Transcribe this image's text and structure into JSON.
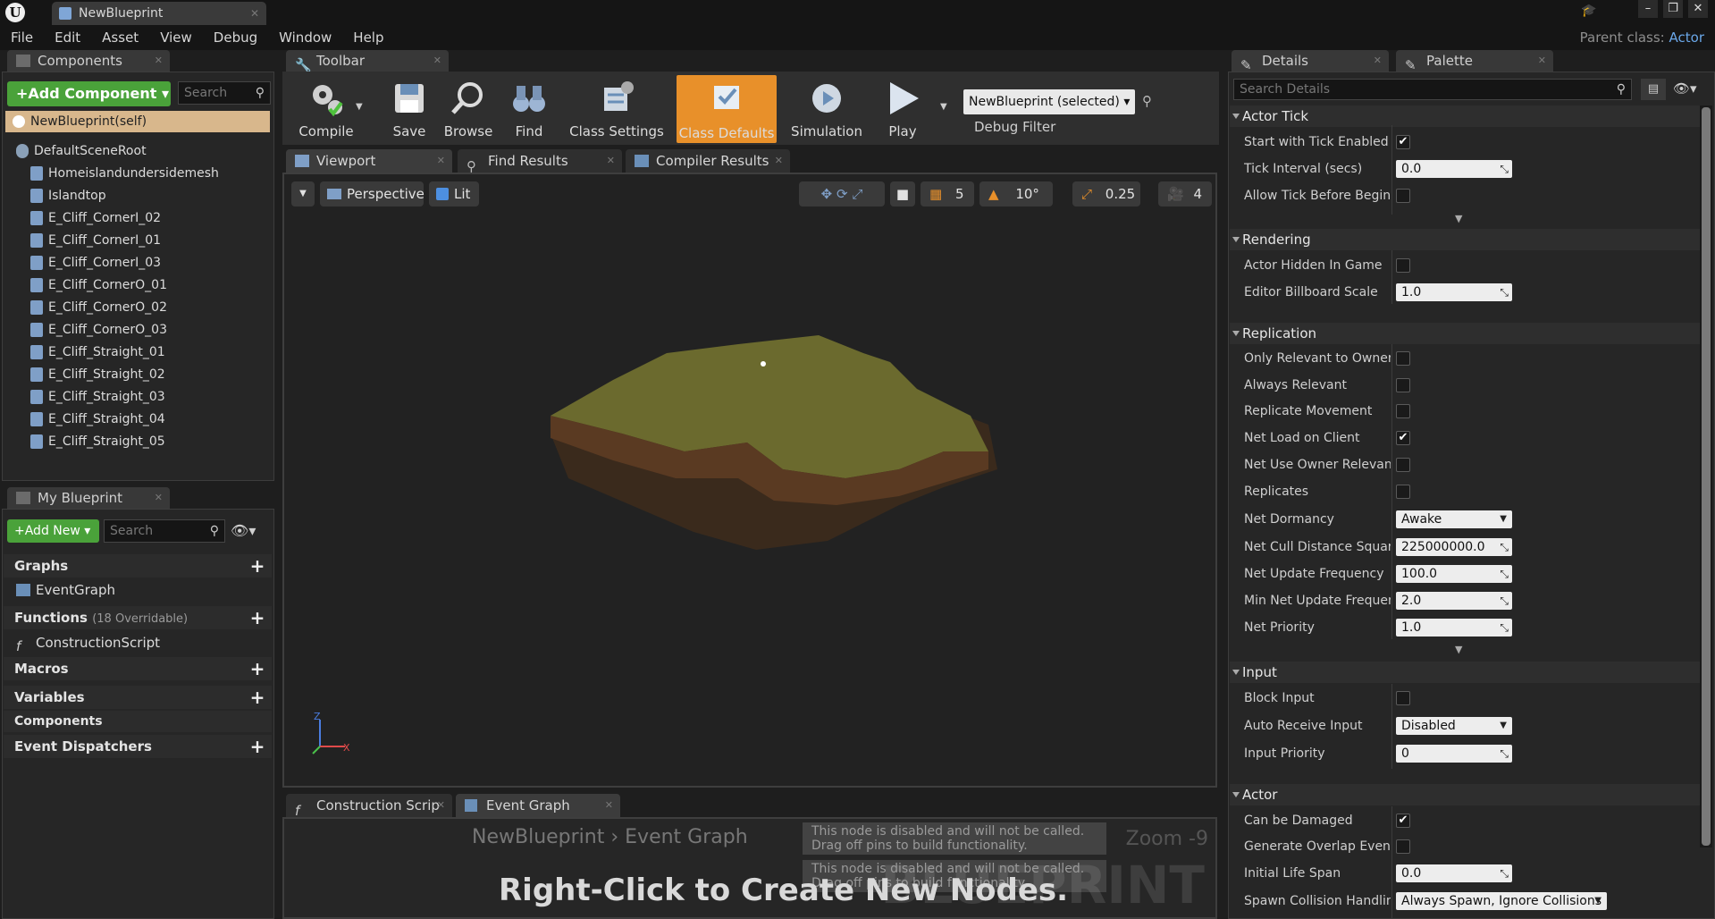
{
  "window": {
    "tab_title": "NewBlueprint",
    "parent_class_label": "Parent class:",
    "parent_class_value": "Actor",
    "logo": "U"
  },
  "menu": [
    "File",
    "Edit",
    "Asset",
    "View",
    "Debug",
    "Window",
    "Help"
  ],
  "components_panel": {
    "tab": "Components",
    "add_button": "+Add Component ▾",
    "search_placeholder": "Search",
    "self": "NewBlueprint(self)",
    "root": "DefaultSceneRoot",
    "items": [
      "Homeislandundersidemesh",
      "Islandtop",
      "E_Cliff_CornerI_02",
      "E_Cliff_CornerI_01",
      "E_Cliff_CornerI_03",
      "E_Cliff_CornerO_01",
      "E_Cliff_CornerO_02",
      "E_Cliff_CornerO_03",
      "E_Cliff_Straight_01",
      "E_Cliff_Straight_02",
      "E_Cliff_Straight_03",
      "E_Cliff_Straight_04",
      "E_Cliff_Straight_05"
    ]
  },
  "my_blueprint": {
    "tab": "My Blueprint",
    "add_button": "+Add New ▾",
    "search_placeholder": "Search",
    "graphs": "Graphs",
    "event_graph": "EventGraph",
    "functions": "Functions",
    "functions_sub": "(18 Overridable)",
    "construction_script": "ConstructionScript",
    "macros": "Macros",
    "variables": "Variables",
    "components": "Components",
    "event_dispatchers": "Event Dispatchers"
  },
  "toolbar": {
    "tab": "Toolbar",
    "buttons": [
      "Compile",
      "Save",
      "Browse",
      "Find",
      "Class Settings",
      "Class Defaults",
      "Simulation",
      "Play"
    ],
    "debug_selected": "NewBlueprint (selected) ▾",
    "debug_filter": "Debug Filter",
    "active_color": "#e8902a"
  },
  "viewport": {
    "tabs": [
      "Viewport",
      "Find Results",
      "Compiler Results"
    ],
    "perspective": "Perspective",
    "lit": "Lit",
    "grid_snap": "5",
    "rotation_snap": "10°",
    "scale_snap": "0.25",
    "camera_speed": "4"
  },
  "graph": {
    "tabs": [
      "Construction Scrip",
      "Event Graph"
    ],
    "hint": "Right-Click to Create New Nodes.",
    "crumb": "NewBlueprint  ›  Event Graph",
    "zoom": "Zoom -9",
    "watermark": "BLUEPRINT",
    "note1": "This node is disabled and will not be called.",
    "note2": "Drag off pins to build functionality."
  },
  "details": {
    "tabs": [
      "Details",
      "Palette"
    ],
    "search_placeholder": "Search Details",
    "categories": {
      "actor_tick": "Actor Tick",
      "rendering": "Rendering",
      "replication": "Replication",
      "input": "Input",
      "actor": "Actor"
    },
    "props": {
      "start_tick": "Start with Tick Enabled",
      "tick_interval": "Tick Interval (secs)",
      "tick_interval_val": "0.0",
      "allow_tick": "Allow Tick Before Begin P",
      "hidden_in_game": "Actor Hidden In Game",
      "billboard_scale": "Editor Billboard Scale",
      "billboard_scale_val": "1.0",
      "only_relevant": "Only Relevant to Owner",
      "always_relevant": "Always Relevant",
      "replicate_movement": "Replicate Movement",
      "net_load": "Net Load on Client",
      "net_owner": "Net Use Owner Relevancy",
      "replicates": "Replicates",
      "net_dormancy": "Net Dormancy",
      "net_dormancy_val": "Awake",
      "net_cull": "Net Cull Distance Squared",
      "net_cull_val": "225000000.0",
      "net_update": "Net Update Frequency",
      "net_update_val": "100.0",
      "min_net_update": "Min Net Update Frequency",
      "min_net_update_val": "2.0",
      "net_priority": "Net Priority",
      "net_priority_val": "1.0",
      "block_input": "Block Input",
      "auto_input": "Auto Receive Input",
      "auto_input_val": "Disabled",
      "input_priority": "Input Priority",
      "input_priority_val": "0",
      "can_be_damaged": "Can be Damaged",
      "overlap_events": "Generate Overlap Events",
      "life_span": "Initial Life Span",
      "life_span_val": "0.0",
      "spawn_collision": "Spawn Collision Handling",
      "spawn_collision_val": "Always Spawn, Ignore Collisions"
    }
  }
}
